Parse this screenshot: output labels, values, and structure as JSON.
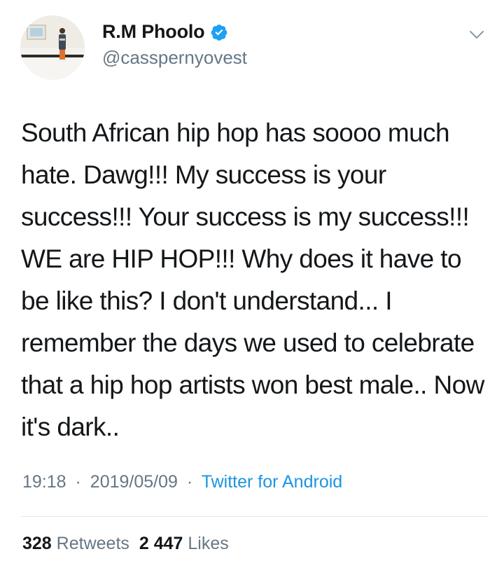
{
  "author": {
    "display_name": "R.M Phoolo",
    "handle": "@casspernyovest",
    "verified": true,
    "verified_icon": "verified-badge-icon",
    "verified_color": "#1da1f2"
  },
  "menu_icon": "chevron-down-icon",
  "tweet": {
    "text": "South African hip hop has soooo much hate. Dawg!!! My success is your success!!! Your success is my success!!! WE are HIP HOP!!! Why does it have to be like this? I don't understand... I remember the days we used to celebrate that a hip hop artists won best male.. Now it's dark.."
  },
  "meta": {
    "time": "19:18",
    "separator": "·",
    "date": "2019/05/09",
    "source": "Twitter for Android",
    "source_color": "#1b95e0"
  },
  "stats": {
    "retweets_count": "328",
    "retweets_label": "Retweets",
    "likes_count": "2 447",
    "likes_label": "Likes"
  }
}
